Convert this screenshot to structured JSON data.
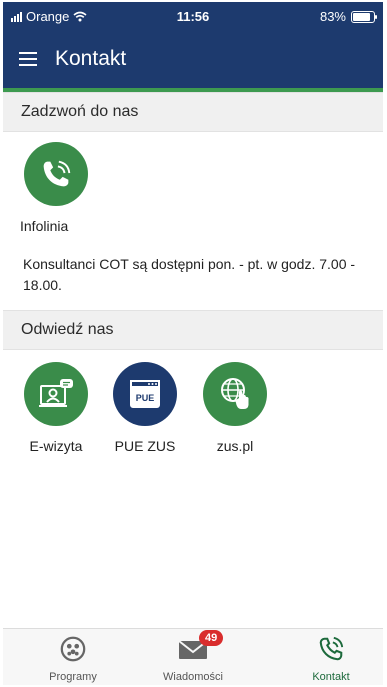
{
  "status": {
    "carrier": "Orange",
    "time": "11:56",
    "battery": "83%",
    "battery_level": 0.83
  },
  "header": {
    "title": "Kontakt"
  },
  "section_call": {
    "title": "Zadzwoń do nas",
    "tile": {
      "label": "Infolinia",
      "icon": "phone-icon"
    },
    "info": "Konsultanci COT są dostępni pon. - pt. w godz. 7.00 - 18.00."
  },
  "section_visit": {
    "title": "Odwiedź nas",
    "tiles": [
      {
        "label": "E-wizyta",
        "icon": "video-consult-icon"
      },
      {
        "label": "PUE ZUS",
        "icon": "pue-icon",
        "badge_text": "PUE"
      },
      {
        "label": "zus.pl",
        "icon": "globe-hand-icon"
      }
    ]
  },
  "bottom_nav": {
    "items": [
      {
        "label": "Programy",
        "icon": "programs-icon"
      },
      {
        "label": "Wiadomości",
        "icon": "mail-icon",
        "badge": "49"
      },
      {
        "label": "Kontakt",
        "icon": "phone-contact-icon",
        "active": true
      }
    ]
  },
  "colors": {
    "header": "#1d3a6e",
    "accent_green": "#3a8c4a",
    "badge_red": "#d92d2d"
  }
}
